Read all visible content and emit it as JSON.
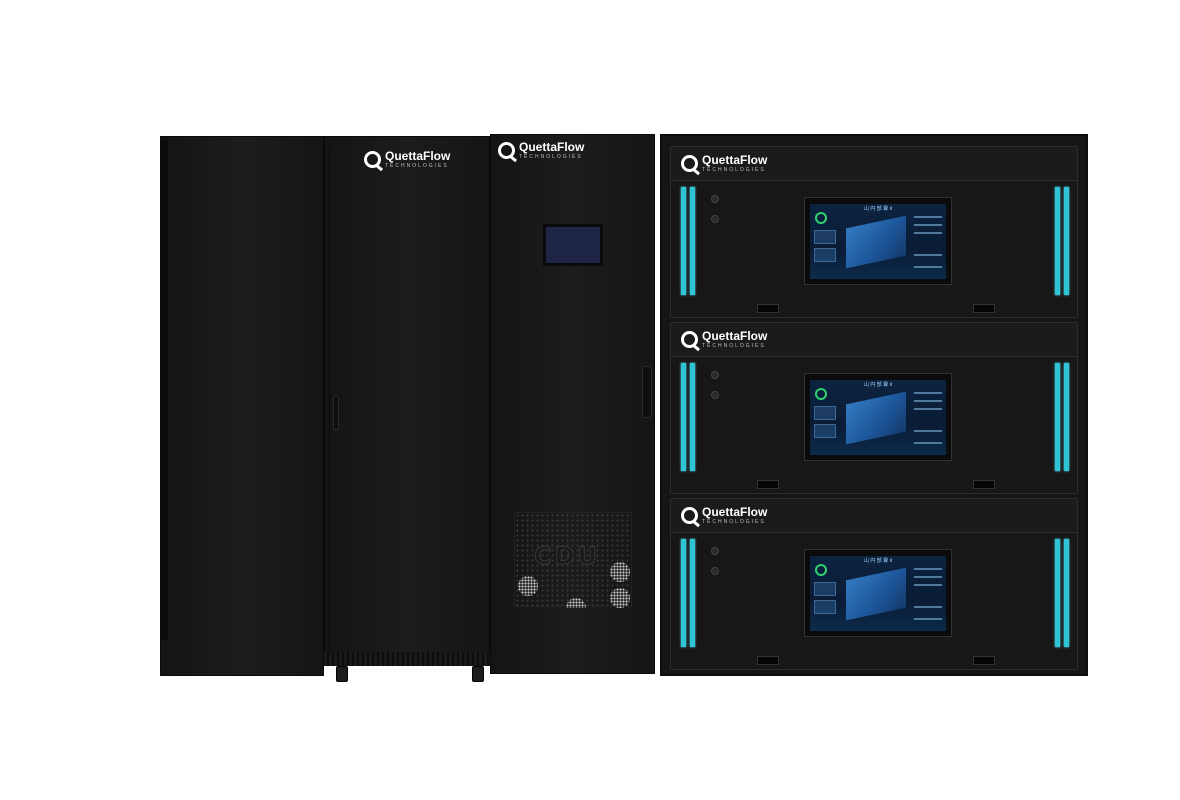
{
  "brand": {
    "name": "QuettaFlow",
    "tagline": "TECHNOLOGIES"
  },
  "cdu_label": "CDU",
  "screen": {
    "title": "山 円 部 寶 Ⅱ"
  },
  "colors": {
    "cabinet": "#151515",
    "indicator_strip": "#2ec4d6",
    "screen_bg": "#0c2340"
  }
}
